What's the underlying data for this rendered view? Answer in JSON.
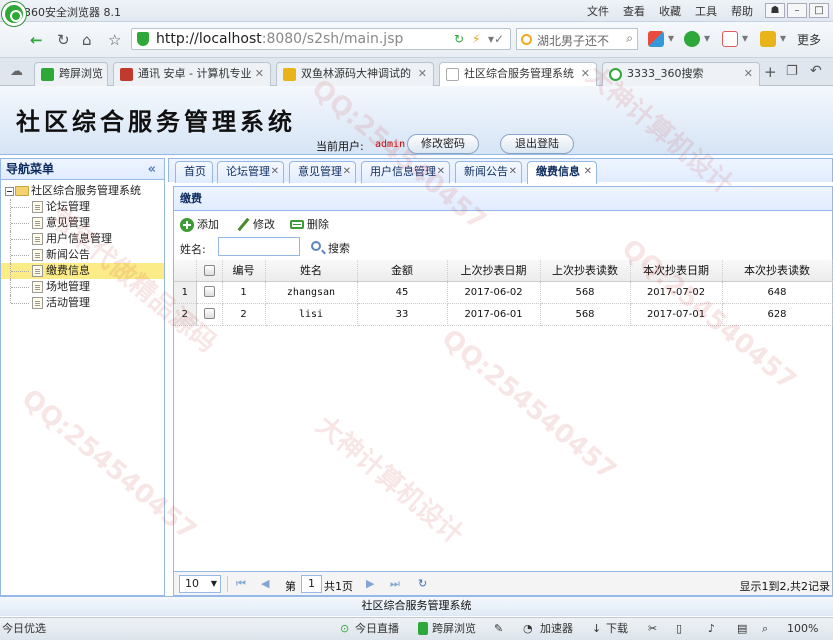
{
  "browser": {
    "app_name": "360安全浏览器 8.1",
    "menu": [
      "文件",
      "查看",
      "收藏",
      "工具",
      "帮助"
    ],
    "url_host": "http://localhost",
    "url_rest": ":8080/s2sh/main.jsp",
    "search_text": "湖北男子还不",
    "more_label": "更多",
    "tabs": [
      {
        "label": "跨屏浏览",
        "color": "#2fa83a"
      },
      {
        "label": "通讯 安卓 - 计算机专业",
        "color": "#c0392b"
      },
      {
        "label": "双鱼林源码大神调试的",
        "color": "#e8b41a"
      },
      {
        "label": "社区综合服务管理系统",
        "color": "#aaaaaa"
      },
      {
        "label": "3333_360搜索",
        "color": "#2fa83a"
      }
    ]
  },
  "app": {
    "title": "社区综合服务管理系统",
    "current_user_label": "当前用户:",
    "current_user": "admin",
    "change_pwd_label": "修改密码",
    "logout_label": "退出登陆"
  },
  "nav": {
    "title": "导航菜单",
    "root": "社区综合服务管理系统",
    "items": [
      "论坛管理",
      "意见管理",
      "用户信息管理",
      "新闻公告",
      "缴费信息",
      "场地管理",
      "活动管理"
    ],
    "selected": "缴费信息"
  },
  "content_tabs": [
    {
      "label": "首页",
      "closable": false
    },
    {
      "label": "论坛管理",
      "closable": true
    },
    {
      "label": "意见管理",
      "closable": true
    },
    {
      "label": "用户信息管理",
      "closable": true
    },
    {
      "label": "新闻公告",
      "closable": true
    },
    {
      "label": "缴费信息",
      "closable": true,
      "active": true
    }
  ],
  "panel": {
    "title": "缴费",
    "add_label": "添加",
    "edit_label": "修改",
    "delete_label": "删除",
    "name_label": "姓名:",
    "name_value": "",
    "search_label": "搜索"
  },
  "grid": {
    "columns": [
      "编号",
      "姓名",
      "金额",
      "上次抄表日期",
      "上次抄表读数",
      "本次抄表日期",
      "本次抄表读数"
    ],
    "rows": [
      {
        "rownum": "1",
        "id": "1",
        "name": "zhangsan",
        "amount": "45",
        "last_date": "2017-06-02",
        "last_reading": "568",
        "this_date": "2017-07-02",
        "this_reading": "648"
      },
      {
        "rownum": "2",
        "id": "2",
        "name": "lisi",
        "amount": "33",
        "last_date": "2017-06-01",
        "last_reading": "568",
        "this_date": "2017-07-01",
        "this_reading": "628"
      }
    ]
  },
  "pager": {
    "page_size": "10",
    "page_label_pre": "第",
    "page_num": "1",
    "page_label_post": "共1页",
    "summary": "显示1到2,共2记录"
  },
  "footer": "社区综合服务管理系统",
  "statusbar": {
    "left": "今日优选",
    "live": "今日直播",
    "cross": "跨屏浏览",
    "accel": "加速器",
    "download": "下载",
    "zoom": "100%"
  },
  "watermark": [
    "QQ:254540457",
    "大神计算机设计",
    "常年代做精品源码"
  ]
}
